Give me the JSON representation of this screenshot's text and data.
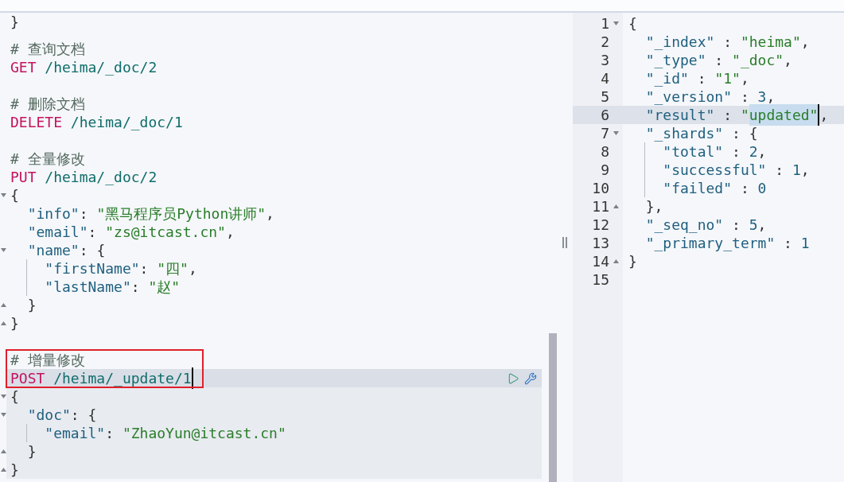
{
  "request_editor": {
    "blocks": [
      {
        "selected": false,
        "body": [
          {
            "tokens": [
              {
                "kind": "punct",
                "text": "}"
              }
            ]
          }
        ]
      },
      {
        "selected": false,
        "highlighted": false,
        "comment": "# 查询文档",
        "request": [
          {
            "kind": "method",
            "text": "GET"
          },
          {
            "kind": "path",
            "text": "/heima/_doc/2"
          }
        ]
      },
      {
        "selected": false,
        "highlighted": false,
        "comment": "# 删除文档",
        "request": [
          {
            "kind": "method",
            "text": "DELETE"
          },
          {
            "kind": "path",
            "text": "/heima/_doc/1"
          }
        ]
      },
      {
        "selected": false,
        "highlighted": false,
        "comment": "# 全量修改",
        "request": [
          {
            "kind": "method",
            "text": "PUT"
          },
          {
            "kind": "path",
            "text": "/heima/_doc/2"
          }
        ],
        "body": [
          {
            "tokens": [
              {
                "kind": "punct",
                "text": "{"
              }
            ],
            "children": [
              {
                "tokens": [
                  {
                    "kind": "key",
                    "text": "\"info\""
                  },
                  {
                    "kind": "punct",
                    "text": ": "
                  },
                  {
                    "kind": "string",
                    "text": "\"黑马程序员Python讲师\""
                  },
                  {
                    "kind": "punct",
                    "text": ","
                  }
                ]
              },
              {
                "tokens": [
                  {
                    "kind": "key",
                    "text": "\"email\""
                  },
                  {
                    "kind": "punct",
                    "text": ": "
                  },
                  {
                    "kind": "string",
                    "text": "\"zs@itcast.cn\""
                  },
                  {
                    "kind": "punct",
                    "text": ","
                  }
                ]
              },
              {
                "tokens": [
                  {
                    "kind": "key",
                    "text": "\"name\""
                  },
                  {
                    "kind": "punct",
                    "text": ": {"
                  }
                ],
                "children": [
                  {
                    "tokens": [
                      {
                        "kind": "key",
                        "text": "\"firstName\""
                      },
                      {
                        "kind": "punct",
                        "text": ": "
                      },
                      {
                        "kind": "string",
                        "text": "\"四\""
                      },
                      {
                        "kind": "punct",
                        "text": ","
                      }
                    ]
                  },
                  {
                    "tokens": [
                      {
                        "kind": "key",
                        "text": "\"lastName\""
                      },
                      {
                        "kind": "punct",
                        "text": ": "
                      },
                      {
                        "kind": "string",
                        "text": "\"赵\""
                      }
                    ]
                  }
                ]
              },
              {
                "tokens": [
                  {
                    "kind": "punct",
                    "text": "}"
                  }
                ]
              }
            ]
          },
          {
            "tokens": [
              {
                "kind": "punct",
                "text": "}"
              }
            ]
          }
        ]
      },
      {
        "selected": true,
        "highlighted": true,
        "comment": "# 增量修改",
        "request": [
          {
            "kind": "method",
            "text": "POST"
          },
          {
            "kind": "path",
            "text": "/heima/_update/1",
            "caret": true
          }
        ],
        "body": [
          {
            "tokens": [
              {
                "kind": "punct",
                "text": "{"
              }
            ],
            "children": [
              {
                "tokens": [
                  {
                    "kind": "key",
                    "text": "\"doc\""
                  },
                  {
                    "kind": "punct",
                    "text": ": {"
                  }
                ],
                "children": [
                  {
                    "tokens": [
                      {
                        "kind": "key",
                        "text": "\"email\""
                      },
                      {
                        "kind": "punct",
                        "text": ": "
                      },
                      {
                        "kind": "string",
                        "text": "\"ZhaoYun@itcast.cn\""
                      }
                    ]
                  }
                ]
              },
              {
                "tokens": [
                  {
                    "kind": "punct",
                    "text": "}"
                  }
                ]
              }
            ]
          },
          {
            "tokens": [
              {
                "kind": "punct",
                "text": "}"
              }
            ]
          }
        ]
      }
    ]
  },
  "response_viewer": {
    "line_numbers": [
      "1",
      "2",
      "3",
      "4",
      "5",
      "6",
      "7",
      "8",
      "9",
      "10",
      "11",
      "12",
      "13",
      "14",
      "15"
    ],
    "lines": [
      {
        "tokens": [
          {
            "kind": "punct",
            "text": "{"
          }
        ],
        "children": [
          {
            "tokens": [
              {
                "kind": "key",
                "text": "\"_index\""
              },
              {
                "kind": "punct",
                "text": " : "
              },
              {
                "kind": "string",
                "text": "\"heima\""
              },
              {
                "kind": "punct",
                "text": ","
              }
            ]
          },
          {
            "tokens": [
              {
                "kind": "key",
                "text": "\"_type\""
              },
              {
                "kind": "punct",
                "text": " : "
              },
              {
                "kind": "string",
                "text": "\"_doc\""
              },
              {
                "kind": "punct",
                "text": ","
              }
            ]
          },
          {
            "tokens": [
              {
                "kind": "key",
                "text": "\"_id\""
              },
              {
                "kind": "punct",
                "text": " : "
              },
              {
                "kind": "string",
                "text": "\"1\""
              },
              {
                "kind": "punct",
                "text": ","
              }
            ]
          },
          {
            "tokens": [
              {
                "kind": "key",
                "text": "\"_version\""
              },
              {
                "kind": "punct",
                "text": " : "
              },
              {
                "kind": "number",
                "text": "3"
              },
              {
                "kind": "punct",
                "text": ","
              }
            ]
          },
          {
            "current": true,
            "tokens": [
              {
                "kind": "key",
                "text": "\"result\""
              },
              {
                "kind": "punct",
                "text": " : "
              },
              {
                "kind": "string",
                "text": "\""
              },
              {
                "kind": "string",
                "text": "updated\"",
                "selected": true,
                "caret": true
              },
              {
                "kind": "punct",
                "text": ","
              }
            ]
          },
          {
            "tokens": [
              {
                "kind": "key",
                "text": "\"_shards\""
              },
              {
                "kind": "punct",
                "text": " : {"
              }
            ],
            "children": [
              {
                "tokens": [
                  {
                    "kind": "key",
                    "text": "\"total\""
                  },
                  {
                    "kind": "punct",
                    "text": " : "
                  },
                  {
                    "kind": "number",
                    "text": "2"
                  },
                  {
                    "kind": "punct",
                    "text": ","
                  }
                ]
              },
              {
                "tokens": [
                  {
                    "kind": "key",
                    "text": "\"successful\""
                  },
                  {
                    "kind": "punct",
                    "text": " : "
                  },
                  {
                    "kind": "number",
                    "text": "1"
                  },
                  {
                    "kind": "punct",
                    "text": ","
                  }
                ]
              },
              {
                "tokens": [
                  {
                    "kind": "key",
                    "text": "\"failed\""
                  },
                  {
                    "kind": "punct",
                    "text": " : "
                  },
                  {
                    "kind": "number",
                    "text": "0"
                  }
                ]
              }
            ]
          },
          {
            "tokens": [
              {
                "kind": "punct",
                "text": "},"
              }
            ]
          },
          {
            "tokens": [
              {
                "kind": "key",
                "text": "\"_seq_no\""
              },
              {
                "kind": "punct",
                "text": " : "
              },
              {
                "kind": "number",
                "text": "5"
              },
              {
                "kind": "punct",
                "text": ","
              }
            ]
          },
          {
            "tokens": [
              {
                "kind": "key",
                "text": "\"_primary_term\""
              },
              {
                "kind": "punct",
                "text": " : "
              },
              {
                "kind": "number",
                "text": "1"
              }
            ]
          }
        ]
      },
      {
        "tokens": [
          {
            "kind": "punct",
            "text": "}"
          }
        ]
      }
    ]
  }
}
